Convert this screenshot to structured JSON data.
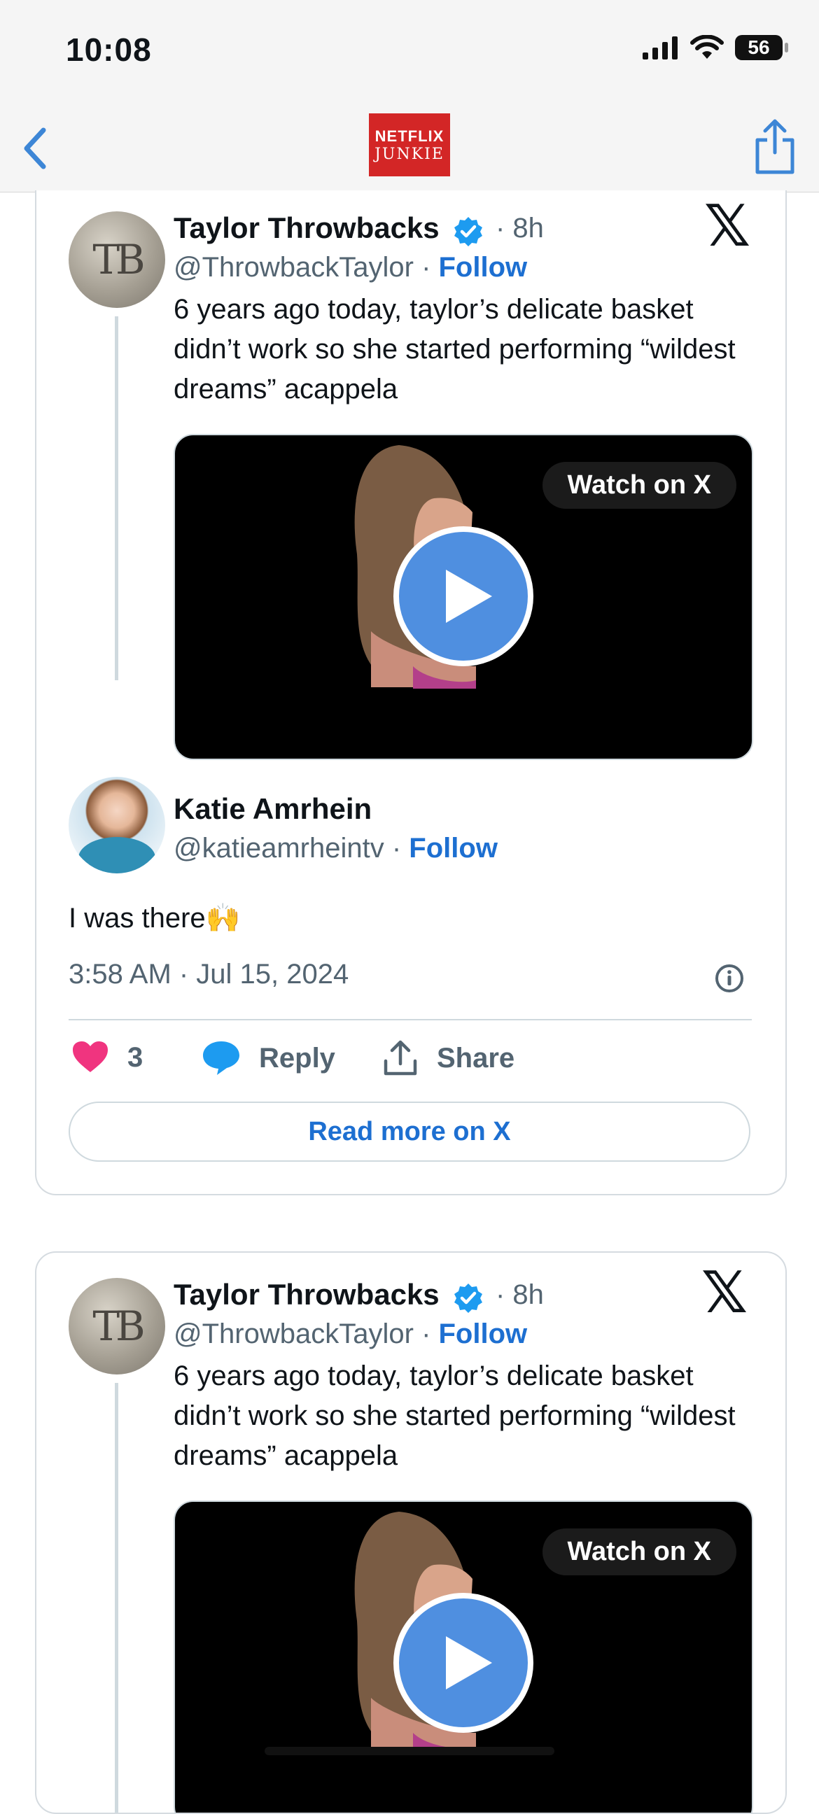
{
  "status_bar": {
    "time": "10:08",
    "battery": "56"
  },
  "nav": {
    "logo_line1": "NETFLIX",
    "logo_line2": "JUNKIE"
  },
  "embeds": [
    {
      "author": {
        "name": "Taylor Throwbacks",
        "time": "· 8h",
        "handle": "@ThrowbackTaylor",
        "follow": "Follow"
      },
      "tweet_text": "6 years ago today, taylor’s delicate basket didn’t work so she started performing “wildest dreams” acappela",
      "media": {
        "watch_label": "Watch on X"
      },
      "reply": {
        "name": "Katie Amrhein",
        "handle": "@katieamrheintv",
        "follow": "Follow",
        "text": "I was there🙌",
        "timestamp": "3:58 AM · Jul 15, 2024"
      },
      "actions": {
        "likes": "3",
        "reply": "Reply",
        "share": "Share"
      },
      "read_more": "Read more on X"
    },
    {
      "author": {
        "name": "Taylor Throwbacks",
        "time": "· 8h",
        "handle": "@ThrowbackTaylor",
        "follow": "Follow"
      },
      "tweet_text": "6 years ago today, taylor’s delicate basket didn’t work so she started performing “wildest dreams” acappela",
      "media": {
        "watch_label": "Watch on X"
      }
    }
  ],
  "colors": {
    "link": "#1d6fd1",
    "like": "#f0347f",
    "reply_icon": "#1d9bf0",
    "play": "#4f8fe0",
    "logo": "#d32626"
  }
}
